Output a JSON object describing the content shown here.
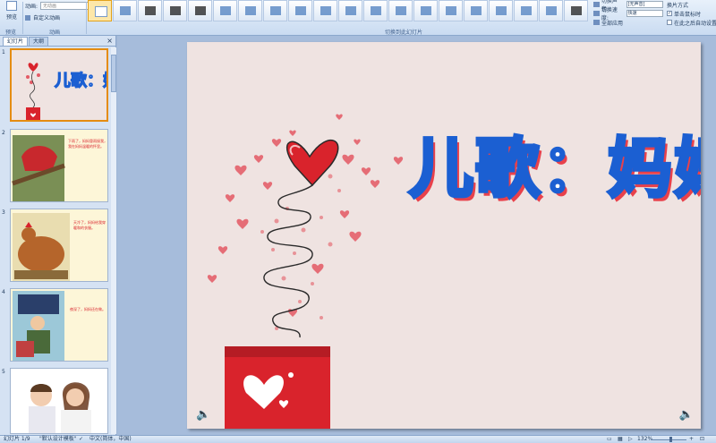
{
  "ribbon": {
    "preview_label": "预览",
    "preview_group_label": "预览",
    "anim_select_label": "动画:",
    "anim_select_value": "无动画",
    "custom_anim_label": "自定义动画",
    "anim_group_label": "动画",
    "transition_group_label": "切换到此幻灯片",
    "sound_label": "切换声音:",
    "sound_value": "[无声音]",
    "speed_label": "切换速度:",
    "speed_value": "快速",
    "apply_all_label": "全部应用",
    "advance_label": "换片方式",
    "on_click_label": "单击鼠标时",
    "on_click_checked": "✓",
    "after_label": "在此之后自动设置"
  },
  "panel": {
    "tab_slides": "幻灯片",
    "tab_outline": "大纲",
    "close": "×",
    "slides": [
      {
        "num": "1"
      },
      {
        "num": "2",
        "text": "下雨了，妈妈冒雨接我，我在妈妈温暖的怀里。"
      },
      {
        "num": "3",
        "text": "天冷了，妈妈给我穿暖和的衣服。"
      },
      {
        "num": "4",
        "text": "夜深了，妈妈还在做。"
      },
      {
        "num": "5"
      }
    ]
  },
  "slide": {
    "title": "儿歌：妈妈",
    "speaker_left": "🔈",
    "speaker_right": "🔈"
  },
  "status": {
    "slide_info": "幻灯片 1/9",
    "theme": "\"默认设计模板\"",
    "language": "中文(简体，中国)",
    "zoom": "132%"
  },
  "colors": {
    "title_fill": "#ffffff",
    "title_outline": "#1b5fd2",
    "title_shadow": "#e8414b",
    "slide_bg": "#efe3e1",
    "gift_box": "#d9232c"
  }
}
